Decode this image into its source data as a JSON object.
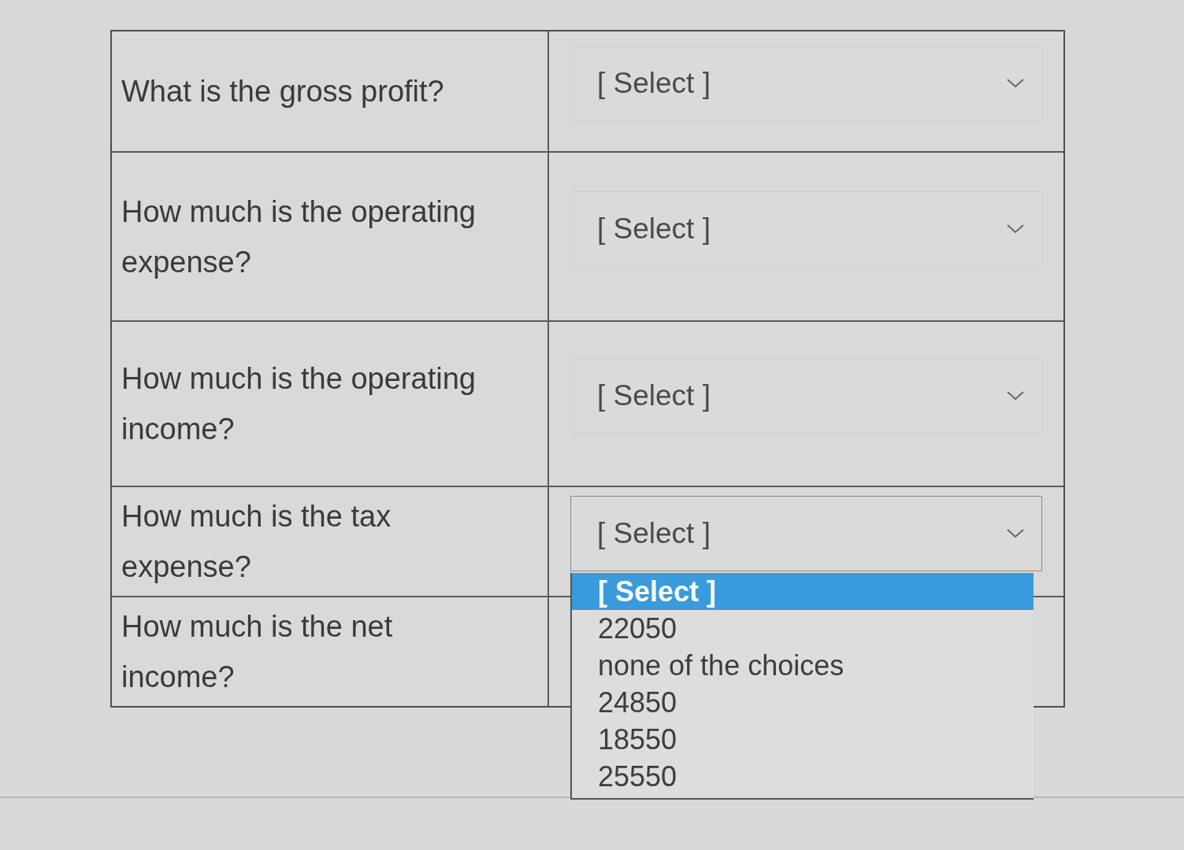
{
  "rows": [
    {
      "question": "What is the gross profit?",
      "dropdown": {
        "value": "[ Select ]",
        "expanded": false
      }
    },
    {
      "question": "How much is the operating expense?",
      "dropdown": {
        "value": "[ Select ]",
        "expanded": false
      }
    },
    {
      "question": "How much is the operating income?",
      "dropdown": {
        "value": "[ Select ]",
        "expanded": false
      }
    },
    {
      "question": "How much is the tax expense?",
      "dropdown": {
        "value": "[ Select ]",
        "expanded": true,
        "options": [
          {
            "label": "[ Select ]",
            "selected": true
          },
          {
            "label": "22050",
            "selected": false
          },
          {
            "label": "none of the choices",
            "selected": false
          },
          {
            "label": "24850",
            "selected": false
          },
          {
            "label": "18550",
            "selected": false
          },
          {
            "label": "25550",
            "selected": false
          }
        ]
      }
    },
    {
      "question": "How much is the net income?"
    }
  ]
}
